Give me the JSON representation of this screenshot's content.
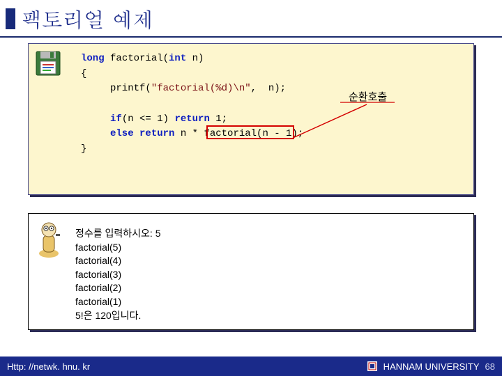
{
  "title": "팩토리얼 예제",
  "code": {
    "l1a": "long",
    "l1b": " factorial(",
    "l1c": "int",
    "l1d": " n)",
    "l2": "{",
    "l3a": "     printf(",
    "l3b": "\"factorial(%d)\\n\"",
    "l3c": ",  n);",
    "l4": "",
    "l5a": "     if",
    "l5b": "(n <= 1) ",
    "l5c": "return",
    "l5d": " 1;",
    "l6a": "     else return",
    "l6b": " n * ",
    "l6c": "factorial(n - 1);",
    "l7": "}"
  },
  "callout": "순환호출",
  "output": "정수를 입력하시오: 5\nfactorial(5)\nfactorial(4)\nfactorial(3)\nfactorial(2)\nfactorial(1)\n5!은 120입니다.",
  "footer": {
    "left": "Http: //netwk. hnu. kr",
    "right": "HANNAM  UNIVERSITY",
    "page": "68"
  }
}
